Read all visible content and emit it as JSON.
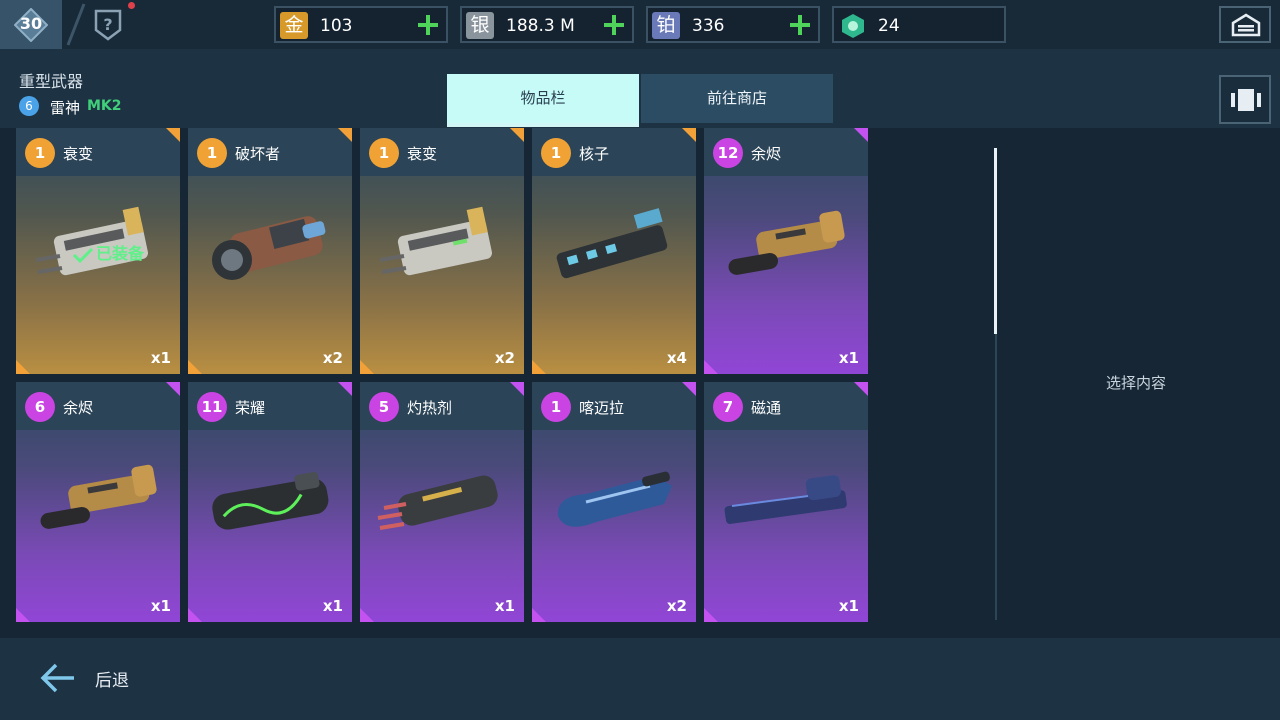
{
  "topbar": {
    "level": "30",
    "currencies": [
      {
        "glyph": "金",
        "value": "103",
        "color": "#d79a2a"
      },
      {
        "glyph": "银",
        "value": "188.3 M",
        "color": "#8a949c"
      },
      {
        "glyph": "铂",
        "value": "336",
        "color": "#6a7ab8"
      },
      {
        "glyph": "",
        "value": "24",
        "color": "#2fb88e"
      }
    ]
  },
  "header": {
    "category": "重型武器",
    "robot_level": "6",
    "robot_name": "雷神",
    "robot_mark": "MK2"
  },
  "tabs": {
    "inventory": "物品栏",
    "shop": "前往商店"
  },
  "items": [
    {
      "level": "1",
      "name": "衰变",
      "qty": "x1",
      "rarity": "gold",
      "equipped_label": "已装备"
    },
    {
      "level": "1",
      "name": "破坏者",
      "qty": "x2",
      "rarity": "gold"
    },
    {
      "level": "1",
      "name": "衰变",
      "qty": "x2",
      "rarity": "gold"
    },
    {
      "level": "1",
      "name": "核子",
      "qty": "x4",
      "rarity": "gold"
    },
    {
      "level": "12",
      "name": "余烬",
      "qty": "x1",
      "rarity": "purple"
    },
    {
      "level": "6",
      "name": "余烬",
      "qty": "x1",
      "rarity": "purple"
    },
    {
      "level": "11",
      "name": "荣耀",
      "qty": "x1",
      "rarity": "purple"
    },
    {
      "level": "5",
      "name": "灼热剂",
      "qty": "x1",
      "rarity": "purple"
    },
    {
      "level": "1",
      "name": "喀迈拉",
      "qty": "x2",
      "rarity": "purple"
    },
    {
      "level": "7",
      "name": "磁通",
      "qty": "x1",
      "rarity": "purple"
    }
  ],
  "detail": {
    "hint": "选择内容"
  },
  "footer": {
    "back_label": "后退"
  }
}
